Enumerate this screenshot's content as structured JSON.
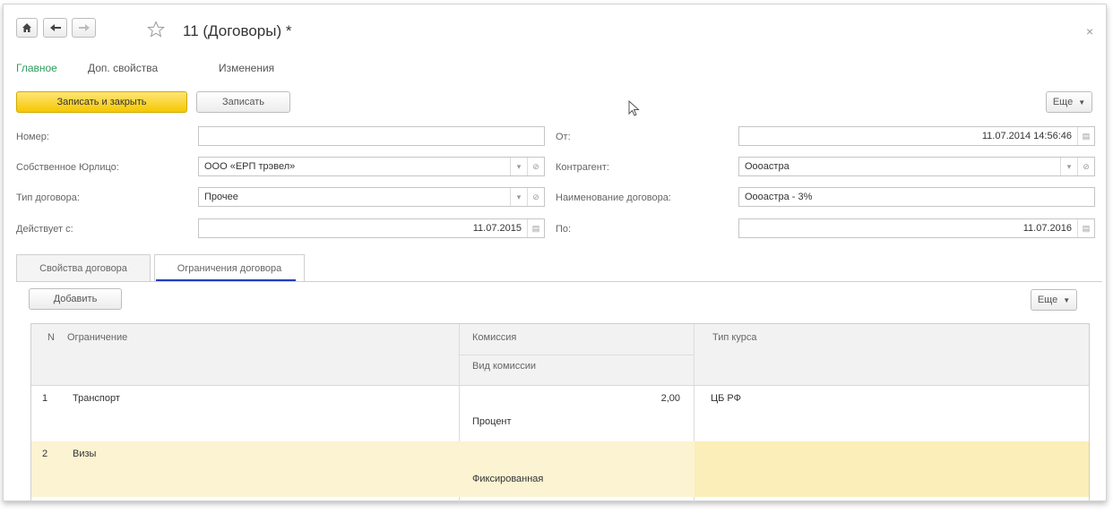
{
  "nav": {
    "home_icon": "home-icon",
    "back_icon": "arrow-left-icon",
    "forward_icon": "arrow-right-icon",
    "star_icon": "star-icon",
    "close_icon": "close-icon"
  },
  "window": {
    "title": "11 (Договоры) *"
  },
  "sections": [
    {
      "label": "Главное"
    },
    {
      "label": "Доп. свойства"
    },
    {
      "label": "Изменения"
    }
  ],
  "toolbar": {
    "save_close": "Записать и закрыть",
    "save": "Записать",
    "more": "Еще"
  },
  "form": {
    "number_label": "Номер:",
    "number_value": "",
    "from_label": "От:",
    "from_value": "11.07.2014 14:56:46",
    "owner_label": "Собственное Юрлицо:",
    "owner_value": "ООО «ЕРП трэвел»",
    "counterparty_label": "Контрагент:",
    "counterparty_value": "Оооастра",
    "type_label": "Тип договора:",
    "type_value": "Прочее",
    "name_label": "Наименование договора:",
    "name_value": "Оооастра - 3%",
    "valid_from_label": "Действует с:",
    "valid_from_value": "11.07.2015",
    "to_label": "По:",
    "to_value": "11.07.2016"
  },
  "tabs": [
    {
      "label": "Свойства договора"
    },
    {
      "label": "Ограничения договора"
    }
  ],
  "table_toolbar": {
    "add": "Добавить",
    "more": "Еще"
  },
  "table": {
    "headers": {
      "n": "N",
      "restriction": "Ограничение",
      "commission": "Комиссия",
      "commission_type": "Вид комиссии",
      "rate_type": "Тип курса"
    },
    "rows": [
      {
        "n": "1",
        "restriction": "Транспорт",
        "commission": "2,00",
        "commission_type": "Процент",
        "rate_type": "ЦБ РФ"
      },
      {
        "n": "2",
        "restriction": "Визы",
        "commission": "",
        "commission_type": "Фиксированная",
        "rate_type": ""
      }
    ]
  },
  "colors": {
    "accent_green": "#2b9d5b",
    "primary_yellow": "#f5c800",
    "selected_row": "#fbeeb8",
    "tab_underline": "#1e3fbf"
  }
}
